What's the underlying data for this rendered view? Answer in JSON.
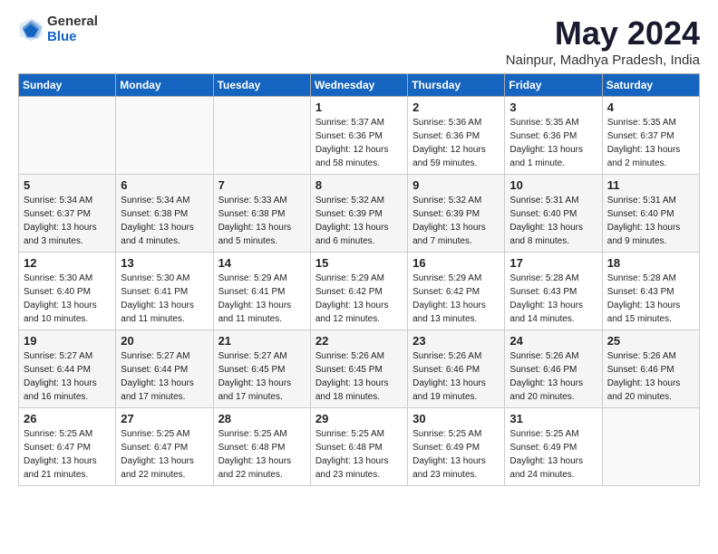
{
  "logo": {
    "general": "General",
    "blue": "Blue"
  },
  "title": "May 2024",
  "location": "Nainpur, Madhya Pradesh, India",
  "days_header": [
    "Sunday",
    "Monday",
    "Tuesday",
    "Wednesday",
    "Thursday",
    "Friday",
    "Saturday"
  ],
  "weeks": [
    [
      {
        "day": "",
        "info": ""
      },
      {
        "day": "",
        "info": ""
      },
      {
        "day": "",
        "info": ""
      },
      {
        "day": "1",
        "info": "Sunrise: 5:37 AM\nSunset: 6:36 PM\nDaylight: 12 hours\nand 58 minutes."
      },
      {
        "day": "2",
        "info": "Sunrise: 5:36 AM\nSunset: 6:36 PM\nDaylight: 12 hours\nand 59 minutes."
      },
      {
        "day": "3",
        "info": "Sunrise: 5:35 AM\nSunset: 6:36 PM\nDaylight: 13 hours\nand 1 minute."
      },
      {
        "day": "4",
        "info": "Sunrise: 5:35 AM\nSunset: 6:37 PM\nDaylight: 13 hours\nand 2 minutes."
      }
    ],
    [
      {
        "day": "5",
        "info": "Sunrise: 5:34 AM\nSunset: 6:37 PM\nDaylight: 13 hours\nand 3 minutes."
      },
      {
        "day": "6",
        "info": "Sunrise: 5:34 AM\nSunset: 6:38 PM\nDaylight: 13 hours\nand 4 minutes."
      },
      {
        "day": "7",
        "info": "Sunrise: 5:33 AM\nSunset: 6:38 PM\nDaylight: 13 hours\nand 5 minutes."
      },
      {
        "day": "8",
        "info": "Sunrise: 5:32 AM\nSunset: 6:39 PM\nDaylight: 13 hours\nand 6 minutes."
      },
      {
        "day": "9",
        "info": "Sunrise: 5:32 AM\nSunset: 6:39 PM\nDaylight: 13 hours\nand 7 minutes."
      },
      {
        "day": "10",
        "info": "Sunrise: 5:31 AM\nSunset: 6:40 PM\nDaylight: 13 hours\nand 8 minutes."
      },
      {
        "day": "11",
        "info": "Sunrise: 5:31 AM\nSunset: 6:40 PM\nDaylight: 13 hours\nand 9 minutes."
      }
    ],
    [
      {
        "day": "12",
        "info": "Sunrise: 5:30 AM\nSunset: 6:40 PM\nDaylight: 13 hours\nand 10 minutes."
      },
      {
        "day": "13",
        "info": "Sunrise: 5:30 AM\nSunset: 6:41 PM\nDaylight: 13 hours\nand 11 minutes."
      },
      {
        "day": "14",
        "info": "Sunrise: 5:29 AM\nSunset: 6:41 PM\nDaylight: 13 hours\nand 11 minutes."
      },
      {
        "day": "15",
        "info": "Sunrise: 5:29 AM\nSunset: 6:42 PM\nDaylight: 13 hours\nand 12 minutes."
      },
      {
        "day": "16",
        "info": "Sunrise: 5:29 AM\nSunset: 6:42 PM\nDaylight: 13 hours\nand 13 minutes."
      },
      {
        "day": "17",
        "info": "Sunrise: 5:28 AM\nSunset: 6:43 PM\nDaylight: 13 hours\nand 14 minutes."
      },
      {
        "day": "18",
        "info": "Sunrise: 5:28 AM\nSunset: 6:43 PM\nDaylight: 13 hours\nand 15 minutes."
      }
    ],
    [
      {
        "day": "19",
        "info": "Sunrise: 5:27 AM\nSunset: 6:44 PM\nDaylight: 13 hours\nand 16 minutes."
      },
      {
        "day": "20",
        "info": "Sunrise: 5:27 AM\nSunset: 6:44 PM\nDaylight: 13 hours\nand 17 minutes."
      },
      {
        "day": "21",
        "info": "Sunrise: 5:27 AM\nSunset: 6:45 PM\nDaylight: 13 hours\nand 17 minutes."
      },
      {
        "day": "22",
        "info": "Sunrise: 5:26 AM\nSunset: 6:45 PM\nDaylight: 13 hours\nand 18 minutes."
      },
      {
        "day": "23",
        "info": "Sunrise: 5:26 AM\nSunset: 6:46 PM\nDaylight: 13 hours\nand 19 minutes."
      },
      {
        "day": "24",
        "info": "Sunrise: 5:26 AM\nSunset: 6:46 PM\nDaylight: 13 hours\nand 20 minutes."
      },
      {
        "day": "25",
        "info": "Sunrise: 5:26 AM\nSunset: 6:46 PM\nDaylight: 13 hours\nand 20 minutes."
      }
    ],
    [
      {
        "day": "26",
        "info": "Sunrise: 5:25 AM\nSunset: 6:47 PM\nDaylight: 13 hours\nand 21 minutes."
      },
      {
        "day": "27",
        "info": "Sunrise: 5:25 AM\nSunset: 6:47 PM\nDaylight: 13 hours\nand 22 minutes."
      },
      {
        "day": "28",
        "info": "Sunrise: 5:25 AM\nSunset: 6:48 PM\nDaylight: 13 hours\nand 22 minutes."
      },
      {
        "day": "29",
        "info": "Sunrise: 5:25 AM\nSunset: 6:48 PM\nDaylight: 13 hours\nand 23 minutes."
      },
      {
        "day": "30",
        "info": "Sunrise: 5:25 AM\nSunset: 6:49 PM\nDaylight: 13 hours\nand 23 minutes."
      },
      {
        "day": "31",
        "info": "Sunrise: 5:25 AM\nSunset: 6:49 PM\nDaylight: 13 hours\nand 24 minutes."
      },
      {
        "day": "",
        "info": ""
      }
    ]
  ]
}
